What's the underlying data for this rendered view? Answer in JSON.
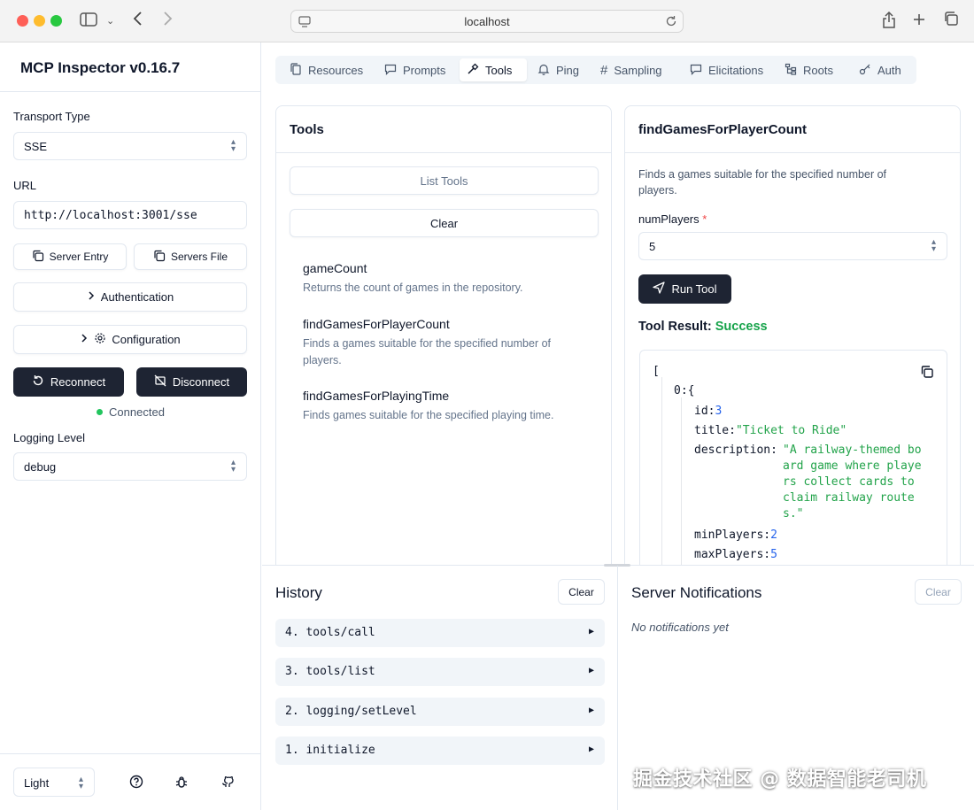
{
  "browser": {
    "url": "localhost"
  },
  "sidebar": {
    "title": "MCP Inspector v0.16.7",
    "transport_label": "Transport Type",
    "transport_value": "SSE",
    "url_label": "URL",
    "url_value": "http://localhost:3001/sse",
    "server_entry_label": "Server Entry",
    "servers_file_label": "Servers File",
    "authentication_label": "Authentication",
    "configuration_label": "Configuration",
    "reconnect_label": "Reconnect",
    "disconnect_label": "Disconnect",
    "status_text": "Connected",
    "status_color": "#22c55e",
    "logging_label": "Logging Level",
    "logging_value": "debug",
    "theme_value": "Light"
  },
  "tabs": [
    {
      "label": "Resources",
      "icon": "files-icon"
    },
    {
      "label": "Prompts",
      "icon": "message-square-icon"
    },
    {
      "label": "Tools",
      "icon": "hammer-icon",
      "active": true
    },
    {
      "label": "Ping",
      "icon": "bell-icon"
    },
    {
      "label": "Sampling",
      "icon": "hash-icon"
    },
    {
      "label": "Elicitations",
      "icon": "message-square-icon"
    },
    {
      "label": "Roots",
      "icon": "folder-tree-icon"
    },
    {
      "label": "Auth",
      "icon": "key-icon"
    }
  ],
  "tools_panel": {
    "title": "Tools",
    "list_tools_label": "List Tools",
    "clear_label": "Clear",
    "items": [
      {
        "name": "gameCount",
        "description": "Returns the count of games in the repository."
      },
      {
        "name": "findGamesForPlayerCount",
        "description": "Finds a games suitable for the specified number of players."
      },
      {
        "name": "findGamesForPlayingTime",
        "description": "Finds games suitable for the specified playing time."
      }
    ]
  },
  "tool_detail": {
    "title": "findGamesForPlayerCount",
    "description": "Finds a games suitable for the specified number of players.",
    "param_label": "numPlayers",
    "param_required_mark": "*",
    "param_value": "5",
    "run_label": "Run Tool",
    "result_label": "Tool Result:",
    "result_status": "Success",
    "result_status_color": "#16a34a",
    "json": {
      "open_bracket": "[",
      "index": "0:",
      "open_brace": "{",
      "id_key": "id:",
      "id_val": "3",
      "title_key": "title:",
      "title_val": "\"Ticket to Ride\"",
      "desc_key": "description:",
      "desc_lines": [
        "\"A railway-themed bo",
        "ard game where playe",
        "rs collect cards to",
        "claim railway route",
        "s.\""
      ],
      "min_key": "minPlayers:",
      "min_val": "2",
      "max_key": "maxPlayers:",
      "max_val": "5"
    }
  },
  "history": {
    "title": "History",
    "clear_label": "Clear",
    "items": [
      "4. tools/call",
      "3. tools/list",
      "2. logging/setLevel",
      "1. initialize"
    ]
  },
  "notifications": {
    "title": "Server Notifications",
    "clear_label": "Clear",
    "empty_text": "No notifications yet"
  },
  "watermark": "掘金技术社区 @ 数据智能老司机"
}
